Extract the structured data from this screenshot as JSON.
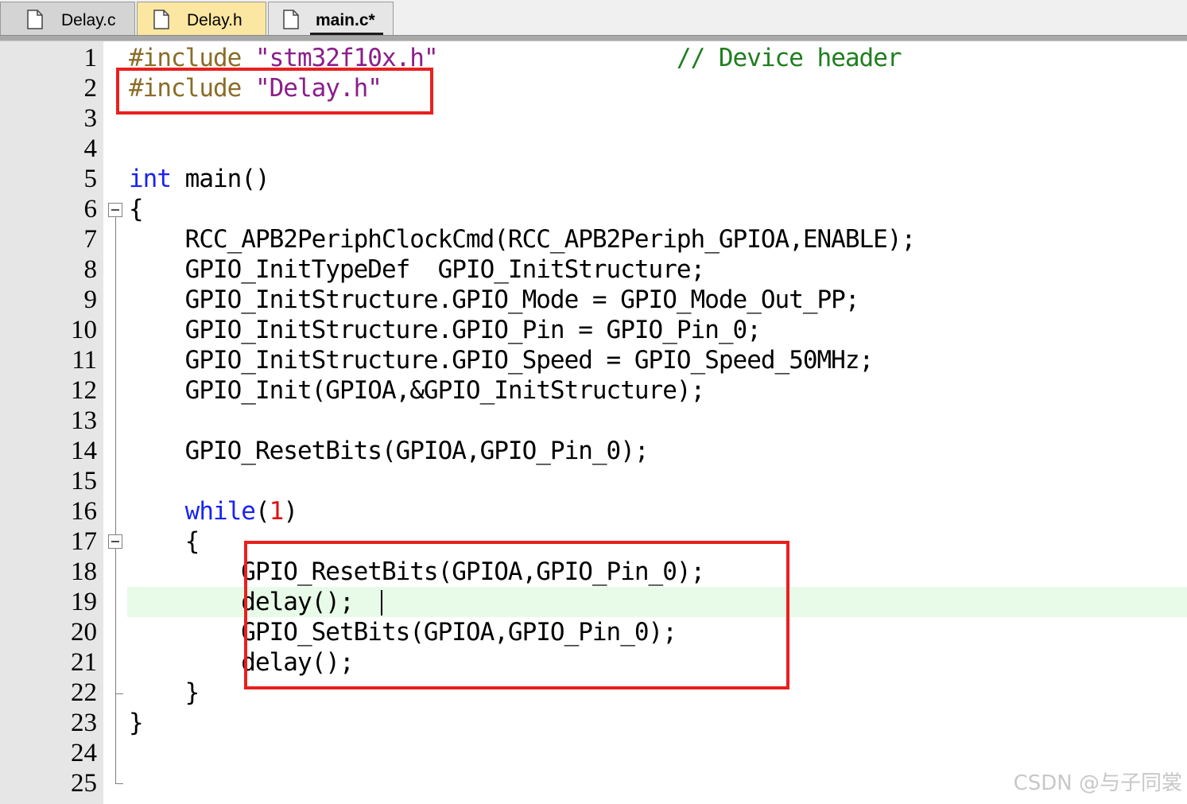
{
  "tabs": [
    {
      "label": "Delay.c",
      "active": false
    },
    {
      "label": "Delay.h",
      "active": false
    },
    {
      "label": "main.c*",
      "active": true
    }
  ],
  "editor": {
    "language": "C",
    "current_line": 19,
    "lines": [
      {
        "n": "1",
        "tokens": [
          [
            "pre",
            "#include "
          ],
          [
            "str",
            "\"stm32f10x.h\""
          ],
          [
            "txt",
            "                 "
          ],
          [
            "cmt",
            "// Device header"
          ]
        ]
      },
      {
        "n": "2",
        "tokens": [
          [
            "pre",
            "#include "
          ],
          [
            "str",
            "\"Delay.h\""
          ]
        ]
      },
      {
        "n": "3",
        "tokens": []
      },
      {
        "n": "4",
        "tokens": []
      },
      {
        "n": "5",
        "tokens": [
          [
            "kw",
            "int"
          ],
          [
            "txt",
            " main()"
          ]
        ]
      },
      {
        "n": "6",
        "tokens": [
          [
            "txt",
            "{"
          ]
        ]
      },
      {
        "n": "7",
        "tokens": [
          [
            "txt",
            "    RCC_APB2PeriphClockCmd(RCC_APB2Periph_GPIOA,ENABLE);"
          ]
        ]
      },
      {
        "n": "8",
        "tokens": [
          [
            "txt",
            "    GPIO_InitTypeDef  GPIO_InitStructure;"
          ]
        ]
      },
      {
        "n": "9",
        "tokens": [
          [
            "txt",
            "    GPIO_InitStructure.GPIO_Mode = GPIO_Mode_Out_PP;"
          ]
        ]
      },
      {
        "n": "10",
        "tokens": [
          [
            "txt",
            "    GPIO_InitStructure.GPIO_Pin = GPIO_Pin_0;"
          ]
        ]
      },
      {
        "n": "11",
        "tokens": [
          [
            "txt",
            "    GPIO_InitStructure.GPIO_Speed = GPIO_Speed_50MHz;"
          ]
        ]
      },
      {
        "n": "12",
        "tokens": [
          [
            "txt",
            "    GPIO_Init(GPIOA,&GPIO_InitStructure);"
          ]
        ]
      },
      {
        "n": "13",
        "tokens": []
      },
      {
        "n": "14",
        "tokens": [
          [
            "txt",
            "    GPIO_ResetBits(GPIOA,GPIO_Pin_0);"
          ]
        ]
      },
      {
        "n": "15",
        "tokens": []
      },
      {
        "n": "16",
        "tokens": [
          [
            "txt",
            "    "
          ],
          [
            "kw",
            "while"
          ],
          [
            "txt",
            "("
          ],
          [
            "num",
            "1"
          ],
          [
            "txt",
            ")"
          ]
        ]
      },
      {
        "n": "17",
        "tokens": [
          [
            "txt",
            "    {"
          ]
        ]
      },
      {
        "n": "18",
        "tokens": [
          [
            "txt",
            "        GPIO_ResetBits(GPIOA,GPIO_Pin_0);"
          ]
        ]
      },
      {
        "n": "19",
        "tokens": [
          [
            "txt",
            "        delay();"
          ]
        ]
      },
      {
        "n": "20",
        "tokens": [
          [
            "txt",
            "        GPIO_SetBits(GPIOA,GPIO_Pin_0);"
          ]
        ]
      },
      {
        "n": "21",
        "tokens": [
          [
            "txt",
            "        delay();"
          ]
        ]
      },
      {
        "n": "22",
        "tokens": [
          [
            "txt",
            "    }"
          ]
        ]
      },
      {
        "n": "23",
        "tokens": [
          [
            "txt",
            "}"
          ]
        ]
      },
      {
        "n": "24",
        "tokens": []
      },
      {
        "n": "25",
        "tokens": []
      }
    ]
  },
  "colors": {
    "preprocessor": "#8a6d28",
    "string": "#8b1e8b",
    "keyword": "#1a24f0",
    "number": "#e01010",
    "comment": "#1f7f1f",
    "annotation_box": "#e8201e",
    "current_line_bg": "#e8fbe8"
  },
  "watermark": "CSDN @与子同裳"
}
